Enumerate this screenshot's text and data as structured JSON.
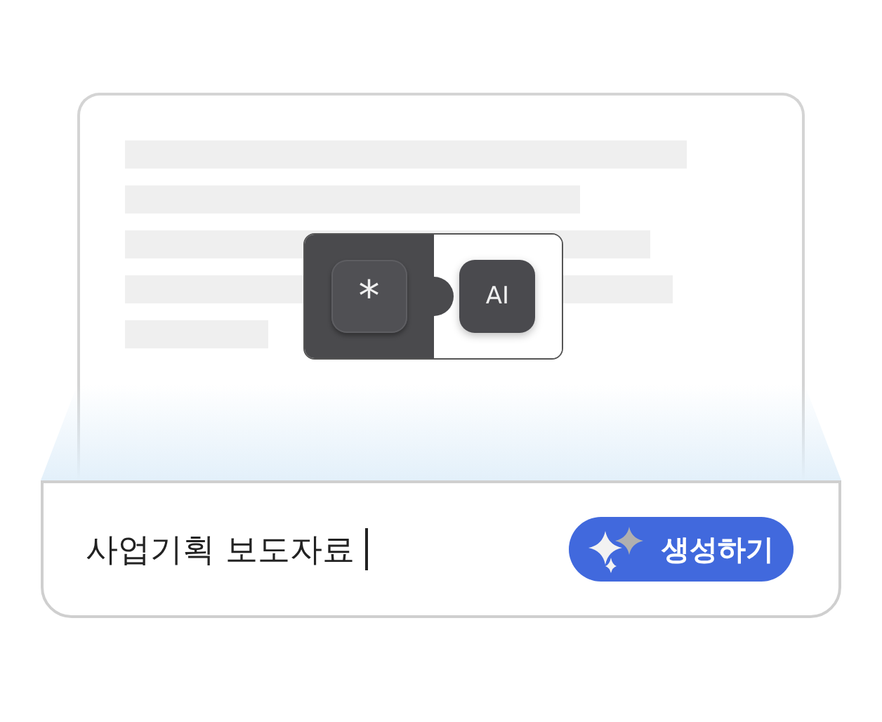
{
  "document": {
    "mode_toggle": {
      "options": [
        {
          "label": "*",
          "selected": true
        },
        {
          "label": "AI",
          "selected": false
        }
      ]
    }
  },
  "prompt_bar": {
    "value": "사업기획 보도자료",
    "button": "생성하기"
  }
}
